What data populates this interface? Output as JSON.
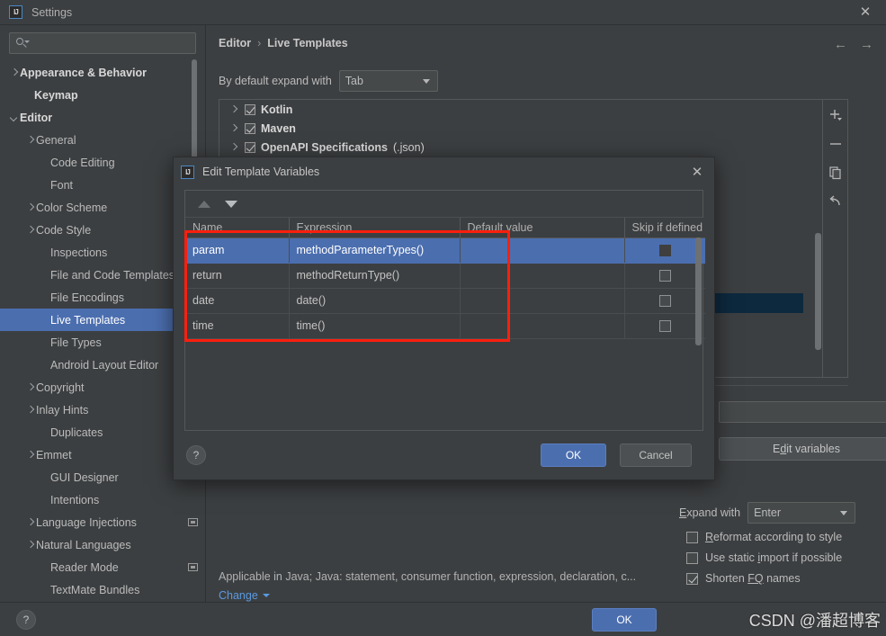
{
  "window": {
    "title": "Settings",
    "logo_text": "IJ",
    "close_icon": "✕"
  },
  "sidebar": {
    "search": {
      "value": "",
      "placeholder": ""
    },
    "items": [
      {
        "label": "Appearance & Behavior",
        "arrow": "right",
        "indent": 10,
        "bold": true,
        "selected": false,
        "badge": false
      },
      {
        "label": "Keymap",
        "arrow": "none",
        "indent": 26,
        "bold": true,
        "selected": false,
        "badge": false
      },
      {
        "label": "Editor",
        "arrow": "down",
        "indent": 10,
        "bold": true,
        "selected": false,
        "badge": false
      },
      {
        "label": "General",
        "arrow": "right",
        "indent": 28,
        "bold": false,
        "selected": false,
        "badge": false
      },
      {
        "label": "Code Editing",
        "arrow": "none",
        "indent": 44,
        "bold": false,
        "selected": false,
        "badge": false
      },
      {
        "label": "Font",
        "arrow": "none",
        "indent": 44,
        "bold": false,
        "selected": false,
        "badge": false
      },
      {
        "label": "Color Scheme",
        "arrow": "right",
        "indent": 28,
        "bold": false,
        "selected": false,
        "badge": false
      },
      {
        "label": "Code Style",
        "arrow": "right",
        "indent": 28,
        "bold": false,
        "selected": false,
        "badge": false
      },
      {
        "label": "Inspections",
        "arrow": "none",
        "indent": 44,
        "bold": false,
        "selected": false,
        "badge": false
      },
      {
        "label": "File and Code Templates",
        "arrow": "none",
        "indent": 44,
        "bold": false,
        "selected": false,
        "badge": false
      },
      {
        "label": "File Encodings",
        "arrow": "none",
        "indent": 44,
        "bold": false,
        "selected": false,
        "badge": false
      },
      {
        "label": "Live Templates",
        "arrow": "none",
        "indent": 44,
        "bold": false,
        "selected": true,
        "badge": false
      },
      {
        "label": "File Types",
        "arrow": "none",
        "indent": 44,
        "bold": false,
        "selected": false,
        "badge": false
      },
      {
        "label": "Android Layout Editor",
        "arrow": "none",
        "indent": 44,
        "bold": false,
        "selected": false,
        "badge": false
      },
      {
        "label": "Copyright",
        "arrow": "right",
        "indent": 28,
        "bold": false,
        "selected": false,
        "badge": false
      },
      {
        "label": "Inlay Hints",
        "arrow": "right",
        "indent": 28,
        "bold": false,
        "selected": false,
        "badge": false
      },
      {
        "label": "Duplicates",
        "arrow": "none",
        "indent": 44,
        "bold": false,
        "selected": false,
        "badge": false
      },
      {
        "label": "Emmet",
        "arrow": "right",
        "indent": 28,
        "bold": false,
        "selected": false,
        "badge": false
      },
      {
        "label": "GUI Designer",
        "arrow": "none",
        "indent": 44,
        "bold": false,
        "selected": false,
        "badge": false
      },
      {
        "label": "Intentions",
        "arrow": "none",
        "indent": 44,
        "bold": false,
        "selected": false,
        "badge": false
      },
      {
        "label": "Language Injections",
        "arrow": "right",
        "indent": 28,
        "bold": false,
        "selected": false,
        "badge": true
      },
      {
        "label": "Natural Languages",
        "arrow": "right",
        "indent": 28,
        "bold": false,
        "selected": false,
        "badge": false
      },
      {
        "label": "Reader Mode",
        "arrow": "none",
        "indent": 44,
        "bold": false,
        "selected": false,
        "badge": true
      },
      {
        "label": "TextMate Bundles",
        "arrow": "none",
        "indent": 44,
        "bold": false,
        "selected": false,
        "badge": false
      }
    ]
  },
  "main": {
    "breadcrumb": {
      "root": "Editor",
      "separator": "›",
      "leaf": "Live Templates"
    },
    "nav": {
      "back_icon": "←",
      "forward_icon": "→"
    },
    "expand_label": "By default expand with",
    "expand_value": "Tab",
    "template_groups": [
      {
        "label": "Kotlin",
        "suffix": "",
        "checked": true
      },
      {
        "label": "Maven",
        "suffix": "",
        "checked": true
      },
      {
        "label": "OpenAPI Specifications",
        "suffix": " (.json)",
        "checked": true
      }
    ],
    "toolbar": {
      "add": "add-icon",
      "remove": "remove-icon",
      "copy": "copy-icon",
      "revert": "revert-icon"
    },
    "applicable_text": "Applicable in Java; Java: statement, consumer function, expression, declaration, c...",
    "change_link": "Change",
    "edit_variables": {
      "prefix": "E",
      "mnemonic": "d",
      "suffix": "it variables"
    },
    "expand_with_label": "Expand with",
    "expand_with_value": "Enter",
    "options": [
      {
        "pre": "",
        "mnemonic": "R",
        "post": "eformat according to style",
        "checked": false
      },
      {
        "pre": "Use static ",
        "mnemonic": "i",
        "post": "mport if possible",
        "checked": false
      },
      {
        "pre": "Shorten ",
        "mnemonic": "FQ",
        "post": " names",
        "checked": true
      }
    ]
  },
  "dialog": {
    "title": "Edit Template Variables",
    "logo_text": "IJ",
    "close_icon": "✕",
    "columns": [
      "Name",
      "Expression",
      "Default value",
      "Skip if defined"
    ],
    "rows": [
      {
        "name": "param",
        "expression": "methodParameterTypes()",
        "default_value": "",
        "skip_if_defined": false,
        "selected": true
      },
      {
        "name": "return",
        "expression": "methodReturnType()",
        "default_value": "",
        "skip_if_defined": false,
        "selected": false
      },
      {
        "name": "date",
        "expression": "date()",
        "default_value": "",
        "skip_if_defined": false,
        "selected": false
      },
      {
        "name": "time",
        "expression": "time()",
        "default_value": "",
        "skip_if_defined": false,
        "selected": false
      }
    ],
    "ok_label": "OK",
    "cancel_label": "Cancel",
    "help_label": "?"
  },
  "footer": {
    "help_label": "?",
    "ok_label": "OK",
    "watermark": "CSDN @潘超博客"
  },
  "colors": {
    "accent": "#4b6eaf",
    "background": "#3c3f41",
    "highlight_box": "#fb1f0e",
    "link": "#5b9ae0"
  }
}
